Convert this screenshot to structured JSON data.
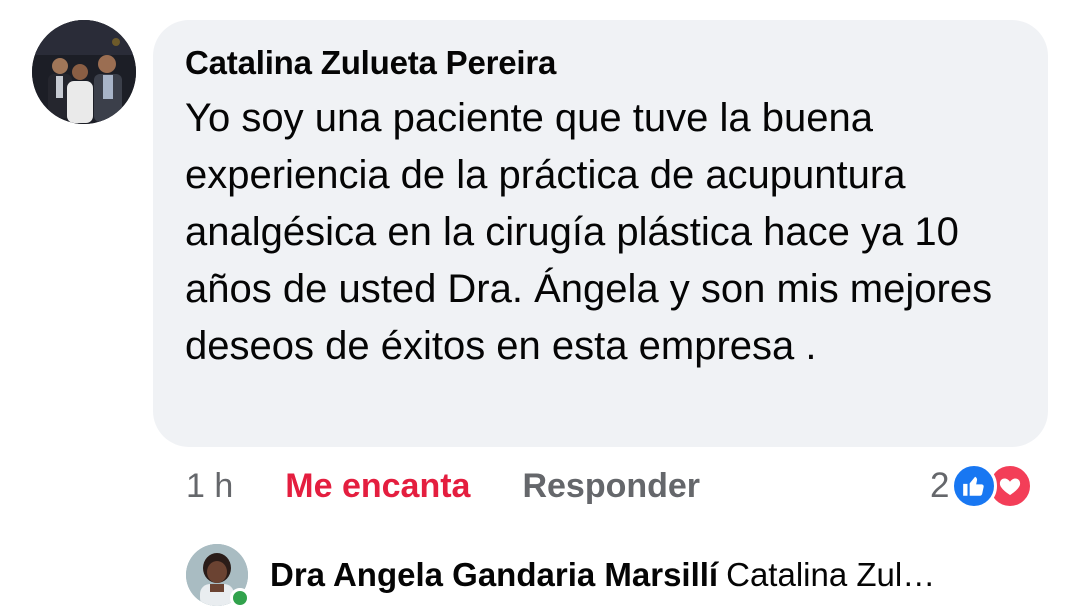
{
  "comment": {
    "author": "Catalina Zulueta Pereira",
    "text": "Yo soy una paciente que tuve la buena experiencia de la práctica de acupuntura analgésica en la cirugía plástica hace ya 10 años de usted Dra. Ángela y son mis mejores deseos de éxitos en esta empresa .",
    "time": "1 h",
    "love_label": "Me encanta",
    "reply_label": "Responder",
    "reaction_count": "2",
    "reaction_icons": [
      "like-icon",
      "love-icon"
    ]
  },
  "reply": {
    "author": "Dra Angela Gandaria Marsillí",
    "snippet": "Catalina Zul…",
    "online": true
  },
  "colors": {
    "bubble": "#f0f2f5",
    "love": "#e41e3f",
    "like_blue": "#1877f2",
    "love_red": "#f33e58",
    "meta_gray": "#65676b",
    "online_green": "#31a24c"
  }
}
